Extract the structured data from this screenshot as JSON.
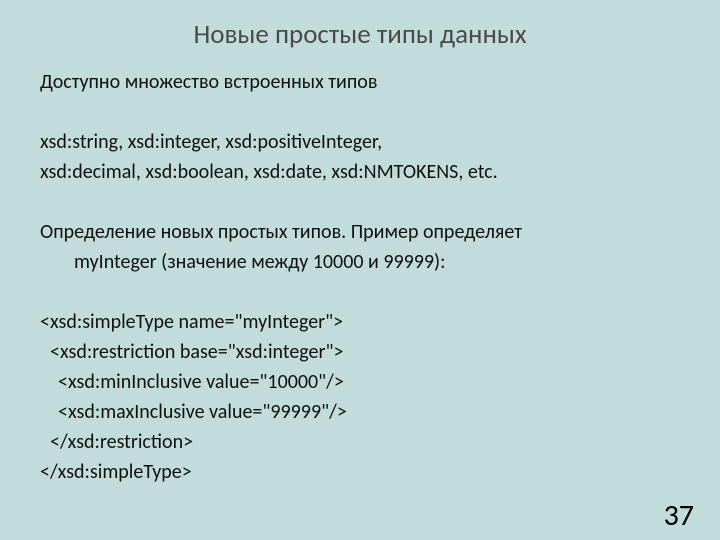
{
  "title": "Новые простые типы данных",
  "body": {
    "p1": "Доступно множество встроенных типов",
    "p2a": "xsd:string, xsd:integer, xsd:positiveInteger,",
    "p2b": "xsd:decimal, xsd:boolean, xsd:date, xsd:NMTOKENS, etc.",
    "p3a": "Определение новых простых типов. Пример определяет",
    "p3b": "myInteger (значение между 10000 и 99999):",
    "code1": "<xsd:simpleType name=\"myInteger\">",
    "code2": "<xsd:restriction base=\"xsd:integer\">",
    "code3": "<xsd:minInclusive value=\"10000\"/>",
    "code4": "<xsd:maxInclusive value=\"99999\"/>",
    "code5": "</xsd:restriction>",
    "code6": "</xsd:simpleType>"
  },
  "page": "37"
}
